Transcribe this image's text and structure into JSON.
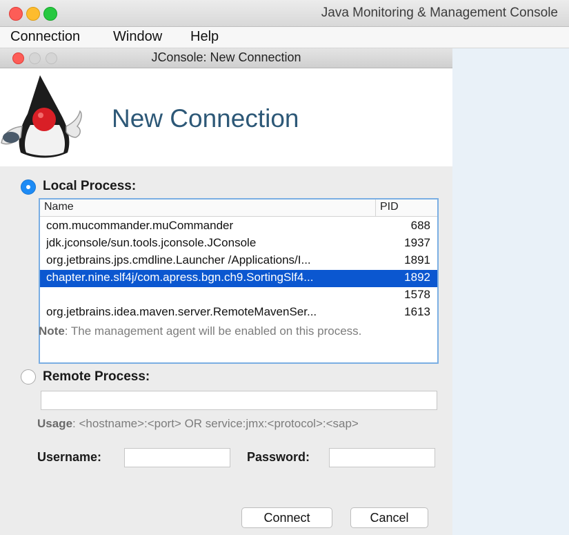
{
  "app": {
    "window_title": "Java Monitoring & Management Console"
  },
  "menu": {
    "items": [
      "Connection",
      "Window",
      "Help"
    ]
  },
  "dialog": {
    "title": "JConsole: New Connection",
    "heading": "New Connection"
  },
  "local_process": {
    "label": "Local Process:",
    "selected": true,
    "columns": [
      "Name",
      "PID"
    ],
    "rows": [
      {
        "name": "com.mucommander.muCommander",
        "pid": "688"
      },
      {
        "name": "jdk.jconsole/sun.tools.jconsole.JConsole",
        "pid": "1937"
      },
      {
        "name": "org.jetbrains.jps.cmdline.Launcher /Applications/I...",
        "pid": "1891"
      },
      {
        "name": "chapter.nine.slf4j/com.apress.bgn.ch9.SortingSlf4...",
        "pid": "1892",
        "selected": true
      },
      {
        "name": "",
        "pid": "1578"
      },
      {
        "name": "org.jetbrains.idea.maven.server.RemoteMavenSer...",
        "pid": "1613"
      }
    ],
    "note_label": "Note",
    "note_text": ": The management agent will be enabled on this process."
  },
  "remote_process": {
    "label": "Remote Process:",
    "selected": false,
    "value": "",
    "usage_label": "Usage",
    "usage_text": ": <hostname>:<port> OR service:jmx:<protocol>:<sap>"
  },
  "credentials": {
    "username_label": "Username:",
    "username_value": "",
    "password_label": "Password:",
    "password_value": ""
  },
  "buttons": {
    "connect": "Connect",
    "cancel": "Cancel"
  },
  "colors": {
    "selection": "#0b57d0",
    "radio_on": "#1d8bf5",
    "heading": "#2d5877"
  }
}
